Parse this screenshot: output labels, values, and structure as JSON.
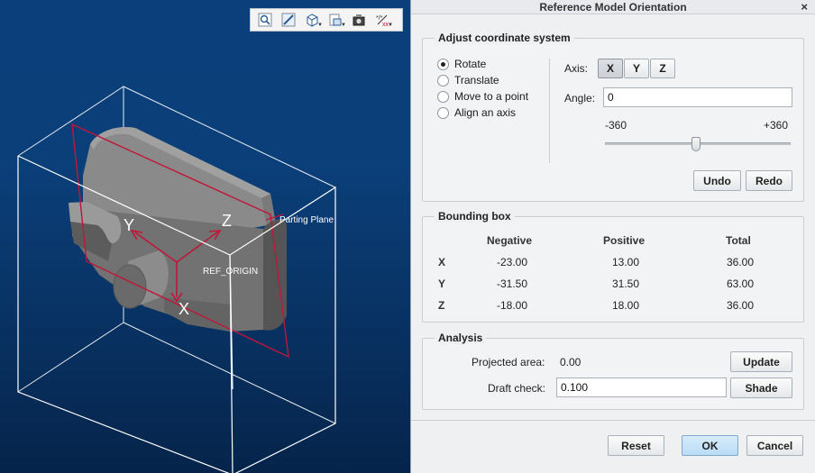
{
  "viewport": {
    "labels": {
      "y_axis": "Y",
      "z_axis": "Z",
      "x_axis": "X",
      "origin": "REF_ORIGIN",
      "plane": "Parting Plane"
    },
    "toolbar": {
      "icons": [
        "zoom-icon",
        "shade-icon",
        "display-style-icon",
        "saved-views-icon",
        "camera-icon",
        "datum-display-icon"
      ]
    },
    "colors": {
      "background": "#0b3f79",
      "wireframe": "#ffffff",
      "parting_plane": "#c0163a",
      "model": "#6e6e6e"
    }
  },
  "dialog": {
    "title": "Reference Model Orientation",
    "close_glyph": "×",
    "coord": {
      "legend": "Adjust coordinate system",
      "modes": [
        {
          "label": "Rotate",
          "selected": true
        },
        {
          "label": "Translate",
          "selected": false
        },
        {
          "label": "Move to a point",
          "selected": false
        },
        {
          "label": "Align an axis",
          "selected": false
        }
      ],
      "axis_label": "Axis:",
      "axes": [
        "X",
        "Y",
        "Z"
      ],
      "active_axis": "X",
      "angle_label": "Angle:",
      "angle_value": "0",
      "slider_min": "-360",
      "slider_max": "+360",
      "slider_value": 0,
      "undo": "Undo",
      "redo": "Redo"
    },
    "bbox": {
      "legend": "Bounding box",
      "headers": [
        "Negative",
        "Positive",
        "Total"
      ],
      "rows": [
        {
          "axis": "X",
          "negative": "-23.00",
          "positive": "13.00",
          "total": "36.00"
        },
        {
          "axis": "Y",
          "negative": "-31.50",
          "positive": "31.50",
          "total": "63.00"
        },
        {
          "axis": "Z",
          "negative": "-18.00",
          "positive": "18.00",
          "total": "36.00"
        }
      ]
    },
    "analysis": {
      "legend": "Analysis",
      "projected_label": "Projected area:",
      "projected_value": "0.00",
      "update": "Update",
      "draft_label": "Draft check:",
      "draft_value": "0.100",
      "shade": "Shade"
    },
    "footer": {
      "reset": "Reset",
      "ok": "OK",
      "cancel": "Cancel"
    }
  }
}
